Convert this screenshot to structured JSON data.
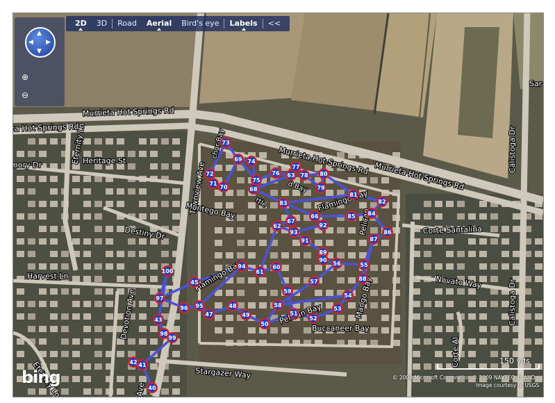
{
  "toolbar": {
    "items": [
      {
        "label": "2D",
        "bold": true,
        "selected": true
      },
      {
        "label": "3D",
        "bold": false,
        "selected": false
      },
      {
        "label": "Road",
        "bold": false,
        "selected": false
      },
      {
        "label": "Aerial",
        "bold": true,
        "selected": true
      },
      {
        "label": "Bird's eye",
        "bold": false,
        "selected": false
      },
      {
        "label": "Labels",
        "bold": true,
        "selected": true
      },
      {
        "label": "<<",
        "bold": false,
        "selected": false
      }
    ]
  },
  "controls": {
    "zoom_in": "⊕",
    "zoom_out": "⊖"
  },
  "logo": "bing",
  "scale_label": "150 yds",
  "copyright_line1": "© 2009 Microsoft Corporation  © 2009 NAVTEQ  © AND",
  "copyright_line2": "Image courtesy of USGS",
  "street_labels": [
    {
      "name": "Murrieta Hot Springs Rd",
      "size": "normal"
    },
    {
      "name": "ta Hot Springs Rd",
      "size": "normal"
    },
    {
      "name": "Murrieta Hot Springs Rd",
      "size": "normal"
    },
    {
      "name": "Murrieta Hot Springs Rd",
      "size": "normal"
    },
    {
      "name": "Heritage St",
      "size": "normal"
    },
    {
      "name": "mory Dr",
      "size": "normal"
    },
    {
      "name": "Eternity Ln",
      "size": "normal"
    },
    {
      "name": "Townview Ave",
      "size": "normal"
    },
    {
      "name": "Montego Bay",
      "size": "normal"
    },
    {
      "name": "Destiny Dr",
      "size": "normal"
    },
    {
      "name": "Harvest Ln",
      "size": "normal"
    },
    {
      "name": "Devotion Ave",
      "size": "normal"
    },
    {
      "name": "Eternity Ln",
      "size": "normal"
    },
    {
      "name": "Stargazer Way",
      "size": "normal"
    },
    {
      "name": "Flamingo Bay",
      "size": "normal"
    },
    {
      "name": "Flamingo Bay",
      "size": "normal"
    },
    {
      "name": "Pelican",
      "size": "normal"
    },
    {
      "name": "Pelican Bay",
      "size": "normal"
    },
    {
      "name": "Mango Bay",
      "size": "normal"
    },
    {
      "name": "Buccaneer Bay",
      "size": "normal"
    },
    {
      "name": "Corte Santalina",
      "size": "normal"
    },
    {
      "name": "Novato Way",
      "size": "normal"
    },
    {
      "name": "Calistoga Dr",
      "size": "normal"
    },
    {
      "name": "Calistoga Dr",
      "size": "normal"
    },
    {
      "name": "Corte Al",
      "size": "normal"
    },
    {
      "name": "Sar",
      "size": "normal"
    },
    {
      "name": "rtle",
      "size": "small"
    },
    {
      "name": "chor Bay",
      "size": "small"
    },
    {
      "name": "d Bay",
      "size": "small"
    },
    {
      "name": "Ave",
      "size": "normal"
    }
  ],
  "waypoints": [
    "73",
    "69",
    "74",
    "72",
    "75",
    "76",
    "77",
    "78",
    "80",
    "79",
    "71",
    "70",
    "68",
    "83",
    "81",
    "82",
    "84",
    "85",
    "66",
    "63",
    "67",
    "62",
    "93",
    "92",
    "86",
    "87",
    "91",
    "89",
    "90",
    "100",
    "94",
    "61",
    "60",
    "56",
    "55",
    "88",
    "45",
    "97",
    "59",
    "57",
    "58",
    "96",
    "95",
    "47",
    "48",
    "49",
    "54",
    "53",
    "51",
    "52",
    "50",
    "43",
    "98",
    "99",
    "42",
    "41",
    "40"
  ],
  "colors": {
    "route": "#4a52d8",
    "marker_fill": "#1a3fc0",
    "marker_ring": "#e02020",
    "toolbar": "#182c60"
  }
}
